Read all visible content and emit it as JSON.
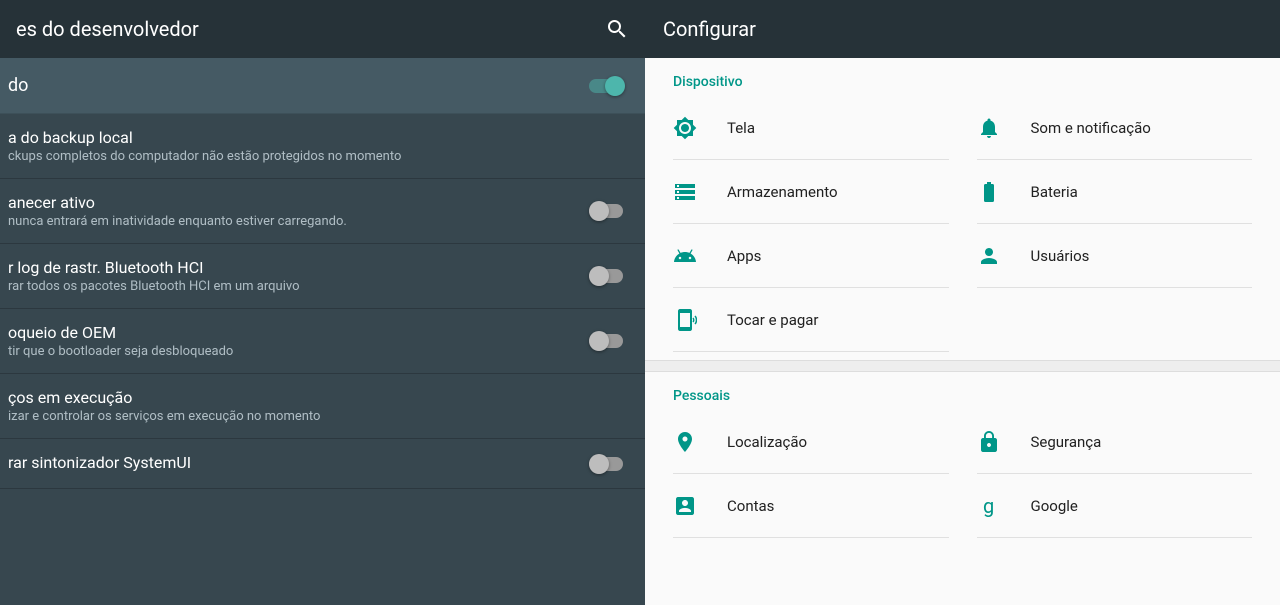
{
  "left": {
    "title": "es do desenvolvedor",
    "master": {
      "label": "do",
      "on": true
    },
    "items": [
      {
        "title": "a do backup local",
        "desc": "ckups completos do computador não estão protegidos no momento",
        "hasToggle": false,
        "on": false
      },
      {
        "title": "anecer ativo",
        "desc": "nunca entrará em inatividade enquanto estiver carregando.",
        "hasToggle": true,
        "on": false
      },
      {
        "title": "r log de rastr. Bluetooth HCI",
        "desc": "rar todos os pacotes Bluetooth HCI em um arquivo",
        "hasToggle": true,
        "on": false
      },
      {
        "title": "oqueio de OEM",
        "desc": "tir que o bootloader seja desbloqueado",
        "hasToggle": true,
        "on": false
      },
      {
        "title": "ços em execução",
        "desc": "izar e controlar os serviços em execução no momento",
        "hasToggle": false,
        "on": false
      },
      {
        "title": "rar sintonizador SystemUI",
        "desc": "",
        "hasToggle": true,
        "on": false
      }
    ]
  },
  "right": {
    "title": "Configurar",
    "sections": [
      {
        "title": "Dispositivo",
        "items": [
          {
            "icon": "brightness",
            "label": "Tela"
          },
          {
            "icon": "bell",
            "label": "Som e notificação"
          },
          {
            "icon": "storage",
            "label": "Armazenamento"
          },
          {
            "icon": "battery",
            "label": "Bateria"
          },
          {
            "icon": "apps",
            "label": "Apps"
          },
          {
            "icon": "person",
            "label": "Usuários"
          },
          {
            "icon": "nfc",
            "label": "Tocar e pagar"
          }
        ]
      },
      {
        "title": "Pessoais",
        "items": [
          {
            "icon": "location",
            "label": "Localização"
          },
          {
            "icon": "lock",
            "label": "Segurança"
          },
          {
            "icon": "account",
            "label": "Contas"
          },
          {
            "icon": "google",
            "label": "Google"
          }
        ]
      }
    ]
  },
  "colors": {
    "accent": "#009688",
    "darkHeader": "#263238",
    "darkPanel": "#37474f"
  }
}
